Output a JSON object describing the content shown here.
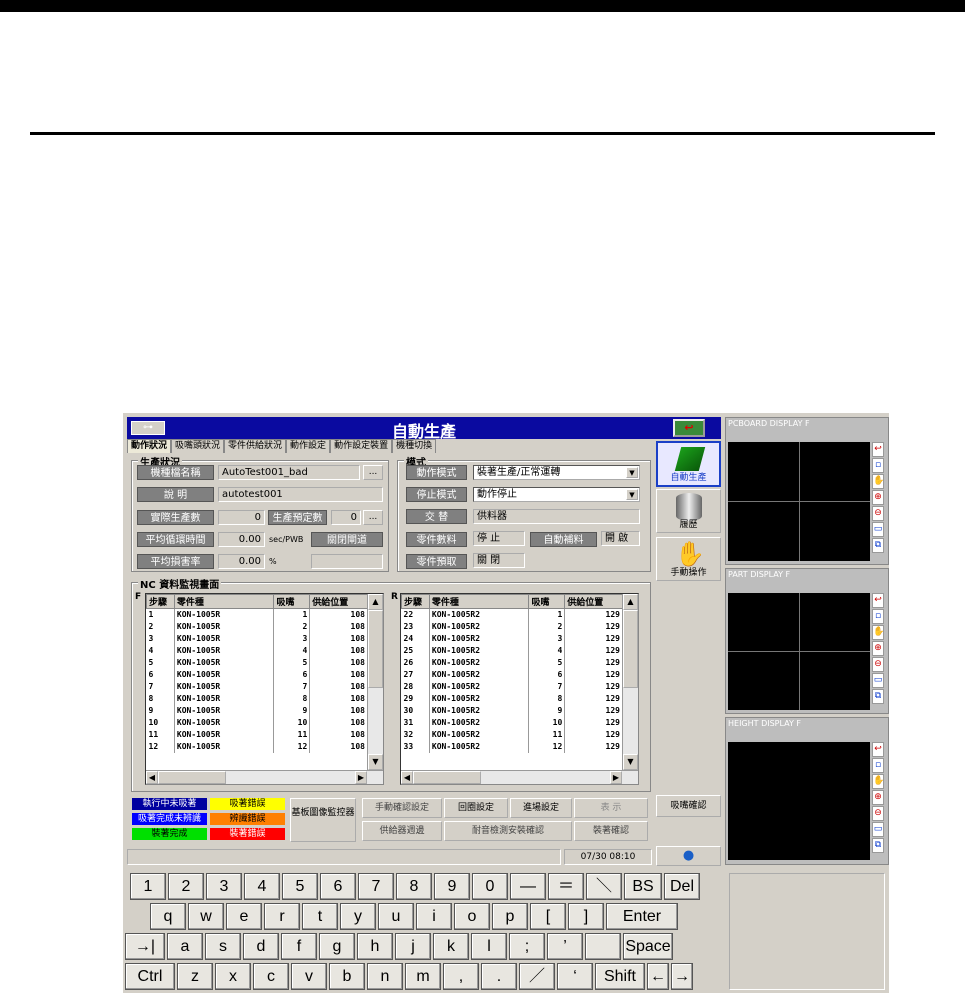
{
  "window": {
    "title": "自動生產"
  },
  "tabs": [
    "動作狀況",
    "吸嘴頭狀況",
    "零件供給狀況",
    "動作設定",
    "動作設定裝置",
    "機種切換"
  ],
  "production": {
    "legend": "生產狀況",
    "model_label": "機種檔名稱",
    "model_value": "AutoTest001_bad",
    "browse": "...",
    "desc_label": "說 明",
    "desc_value": "autotest001",
    "actual_label": "實際生產數",
    "actual_value": "0",
    "planned_label": "生產預定數",
    "planned_value": "0",
    "cycle_label": "平均循環時間",
    "cycle_value": "0.00",
    "cycle_unit": "sec/PWB",
    "gate_btn": "關閉閘道",
    "loss_label": "平均損害率",
    "loss_value": "0.00",
    "loss_unit": "%"
  },
  "mode": {
    "legend": "模式",
    "op_label": "動作模式",
    "op_value": "裝著生產/正常運轉",
    "stop_label": "停止模式",
    "stop_value": "動作停止",
    "swap_label": "交 替",
    "swap_value": "供料器",
    "part_data_label": "零件數料",
    "part_data_value": "停 止",
    "auto_label": "自動補料",
    "auto_value": "開 啟",
    "part_take_label": "零件預取",
    "part_take_value": "關 閉"
  },
  "nc": {
    "legend": "NC 資料監視畫面",
    "front_label": "F",
    "rear_label": "R",
    "headers": [
      "步驟",
      "零件種",
      "吸嘴",
      "供給位置"
    ],
    "front_rows": [
      [
        "1",
        "KON-1005R",
        "1",
        "108"
      ],
      [
        "2",
        "KON-1005R",
        "2",
        "108"
      ],
      [
        "3",
        "KON-1005R",
        "3",
        "108"
      ],
      [
        "4",
        "KON-1005R",
        "4",
        "108"
      ],
      [
        "5",
        "KON-1005R",
        "5",
        "108"
      ],
      [
        "6",
        "KON-1005R",
        "6",
        "108"
      ],
      [
        "7",
        "KON-1005R",
        "7",
        "108"
      ],
      [
        "8",
        "KON-1005R",
        "8",
        "108"
      ],
      [
        "9",
        "KON-1005R",
        "9",
        "108"
      ],
      [
        "10",
        "KON-1005R",
        "10",
        "108"
      ],
      [
        "11",
        "KON-1005R",
        "11",
        "108"
      ],
      [
        "12",
        "KON-1005R",
        "12",
        "108"
      ]
    ],
    "rear_rows": [
      [
        "22",
        "KON-1005R2",
        "1",
        "129"
      ],
      [
        "23",
        "KON-1005R2",
        "2",
        "129"
      ],
      [
        "24",
        "KON-1005R2",
        "3",
        "129"
      ],
      [
        "25",
        "KON-1005R2",
        "4",
        "129"
      ],
      [
        "26",
        "KON-1005R2",
        "5",
        "129"
      ],
      [
        "27",
        "KON-1005R2",
        "6",
        "129"
      ],
      [
        "28",
        "KON-1005R2",
        "7",
        "129"
      ],
      [
        "29",
        "KON-1005R2",
        "8",
        "129"
      ],
      [
        "30",
        "KON-1005R2",
        "9",
        "129"
      ],
      [
        "31",
        "KON-1005R2",
        "10",
        "129"
      ],
      [
        "32",
        "KON-1005R2",
        "11",
        "129"
      ],
      [
        "33",
        "KON-1005R2",
        "12",
        "129"
      ]
    ]
  },
  "legend_boxes": [
    {
      "text": "執行中未吸著",
      "bg": "#0000a0",
      "fg": "#ffffff"
    },
    {
      "text": "吸著錯誤",
      "bg": "#ffff00",
      "fg": "#000000"
    },
    {
      "text": "吸著完成未辨識",
      "bg": "#0000ff",
      "fg": "#ffffff"
    },
    {
      "text": "辨識錯誤",
      "bg": "#ff8000",
      "fg": "#000000"
    },
    {
      "text": "裝著完成",
      "bg": "#00e000",
      "fg": "#000000"
    },
    {
      "text": "裝著錯誤",
      "bg": "#ff0000",
      "fg": "#ffffff"
    }
  ],
  "board_monitor": "基板圖像監控器",
  "controls": {
    "manual_rec": "手動確認設定",
    "loop": "回圈設定",
    "feed": "進場設定",
    "display": "表 示",
    "supply": "供給器週邊",
    "abnormal": "耐音檢測安裝確認",
    "mount_confirm": "裝著確認"
  },
  "side": {
    "auto_btn": "自動生產",
    "disk_btn": "履歷",
    "manual_btn": "手動操作",
    "nozzle_btn": "吸嘴確認"
  },
  "displays": [
    {
      "title": "PCBOARD DISPLAY F"
    },
    {
      "title": "PART DISPLAY F"
    },
    {
      "title": "HEIGHT DISPLAY F"
    }
  ],
  "status": {
    "datetime": "07/30 08:10"
  },
  "colors": {
    "title_bar": "#0a0aa0",
    "face": "#d4d0c8",
    "display_header": "#bdbdbd"
  },
  "keyboard": {
    "row1": [
      "1",
      "2",
      "3",
      "4",
      "5",
      "6",
      "7",
      "8",
      "9",
      "0",
      "—",
      "＝",
      "＼",
      "BS",
      "Del"
    ],
    "row2": [
      "q",
      "w",
      "e",
      "r",
      "t",
      "y",
      "u",
      "i",
      "o",
      "p",
      "[",
      "]",
      "Enter"
    ],
    "row3": [
      "→|",
      "a",
      "s",
      "d",
      "f",
      "g",
      "h",
      "j",
      "k",
      "l",
      ";",
      "’",
      "",
      "Space"
    ],
    "row4": [
      "Ctrl",
      "z",
      "x",
      "c",
      "v",
      "b",
      "n",
      "m",
      ",",
      ".",
      "／",
      "‘",
      "Shift",
      "←",
      "→"
    ]
  }
}
